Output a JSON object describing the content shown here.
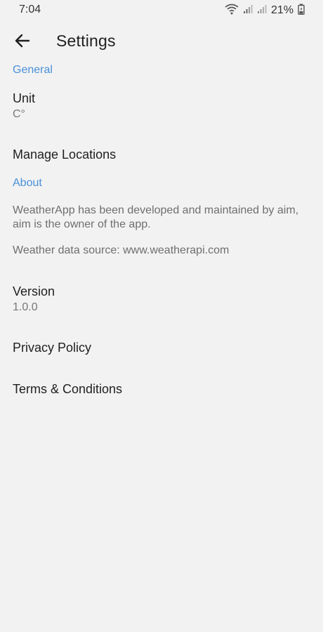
{
  "status_bar": {
    "time": "7:04",
    "battery_percent": "21%",
    "icons": [
      "wifi-icon",
      "signal-icon",
      "signal-icon",
      "battery-charging-icon"
    ]
  },
  "app_bar": {
    "title": "Settings",
    "back_icon": "arrow-left-icon"
  },
  "general": {
    "header": "General",
    "unit_title": "Unit",
    "unit_value": "C°",
    "manage_locations": "Manage Locations"
  },
  "about": {
    "header": "About",
    "description": "WeatherApp has been developed and maintained by aim, aim is the owner of the app.",
    "data_source": "Weather data source: www.weatherapi.com",
    "version_title": "Version",
    "version_value": "1.0.0",
    "privacy_policy": "Privacy Policy",
    "terms": "Terms & Conditions"
  },
  "colors": {
    "accent": "#4a90d9",
    "background": "#f2f2f2",
    "primary_text": "#1f1f1f",
    "secondary_text": "#777777"
  }
}
